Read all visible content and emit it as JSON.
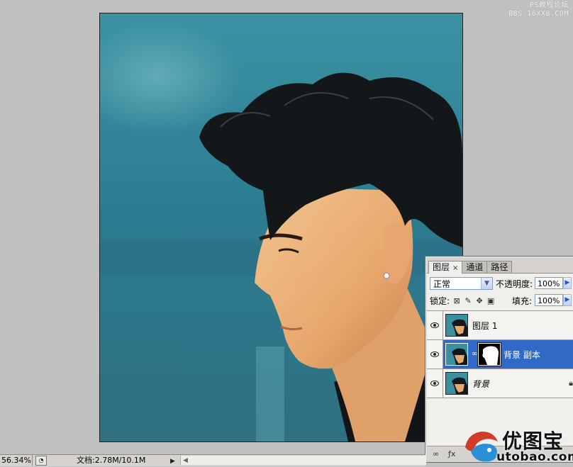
{
  "watermark_top": {
    "line1": "PS教程论坛",
    "line2": "BBS.16XX8.COM"
  },
  "layers_panel": {
    "tabs": [
      {
        "label": "图层",
        "close": "×"
      },
      {
        "label": "通道"
      },
      {
        "label": "路径"
      }
    ],
    "blend_mode": "正常",
    "opacity_label": "不透明度:",
    "opacity_value": "100%",
    "lock_label": "锁定:",
    "fill_label": "填充:",
    "fill_value": "100%",
    "layers": [
      {
        "name": "图层 1",
        "selected": false
      },
      {
        "name": "背景 副本",
        "selected": true,
        "has_mask": true
      },
      {
        "name": "背景",
        "selected": false,
        "locked": true
      }
    ]
  },
  "status_bar": {
    "zoom": "56.34%",
    "doc_info": "文档:2.78M/10.1M"
  },
  "logo": {
    "name": "优图宝",
    "url": "utobao.com"
  },
  "colors": {
    "selection": "#3169c6",
    "panel_bg": "#d6d3ce",
    "canvas_bg": "#c0c0c0"
  }
}
